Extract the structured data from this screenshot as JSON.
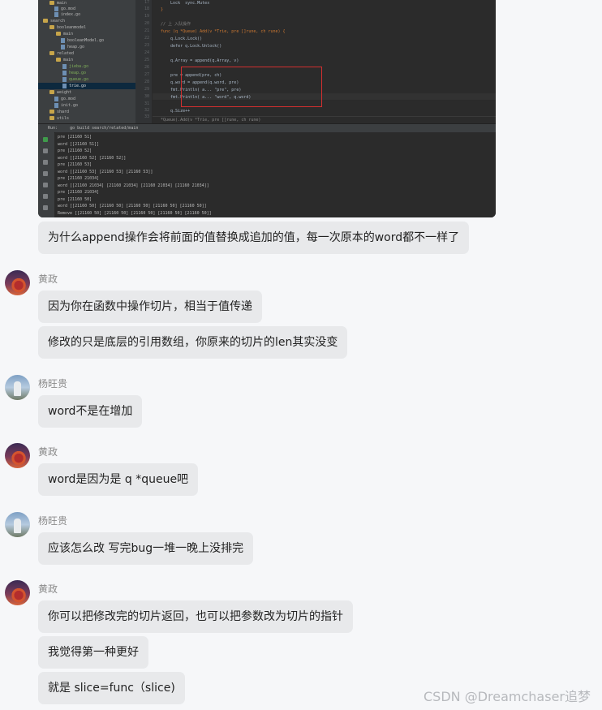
{
  "ide": {
    "tree": [
      "main",
      "go.mod",
      "index.go",
      "search",
      "booleanmodel",
      "main",
      "booleanModel.go",
      "heap.go",
      "related",
      "main",
      "jieba.go",
      "heap.go",
      "queue.go",
      "trie.go",
      "weight",
      "go.mod",
      "init.go",
      "shard",
      "utils"
    ],
    "code": [
      "    Lock  sync.Mutex",
      "}",
      "",
      "// 上 入队操作",
      "func (q *Queue) Add(v *Trie, pre []rune, ch rune) {",
      "    q.Lock.Lock()",
      "    defer q.Lock.Unlock()",
      "",
      "    q.Array = append(q.Array, v)",
      "",
      "    pre = append(pre, ch)",
      "    q.word = append(q.word, pre)",
      "    fmt.Println( a... \"pre\", pre)",
      "    fmt.Println( a... \"word\", q.word)",
      "",
      "    q.Size++",
      "}"
    ],
    "line_numbers": [
      "17",
      "18",
      "19",
      "20",
      "21",
      "22",
      "23",
      "24",
      "25",
      "26",
      "27",
      "28",
      "29",
      "30",
      "31",
      "32",
      "33"
    ],
    "breadcrumb": "*Queue).Add(v *Trie, pre []rune, ch rune)",
    "run_tab": "go build search/related/main",
    "run_label": "Run:",
    "console": [
      "pre [21160 51]",
      "word [[21160 51]]",
      "pre [21160 52]",
      "word [[21160 52] [21160 52]]",
      "pre [21160 53]",
      "word [[21160 53] [21160 53] [21160 53]]",
      "pre [21160 21034]",
      "word [[21160 21034] [21160 21034] [21160 21034] [21160 21034]]",
      "pre [21160 21034]",
      "pre [21160 50]",
      "word [[21160 50] [21160 50] [21160 50] [21160 50] [21160 50]]",
      "Remove [[21160 50] [21160 50] [21160 50] [21160 50] [21160 50]]"
    ]
  },
  "messages": [
    {
      "text": "为什么append操作会将前面的值替换成追加的值，每一次原本的word都不一样了"
    },
    {
      "sender": "黄政",
      "bubbles": [
        "因为你在函数中操作切片，相当于值传递",
        "修改的只是底层的引用数组，你原来的切片的len其实没变"
      ]
    },
    {
      "sender": "杨旺贵",
      "bubbles": [
        "word不是在增加"
      ]
    },
    {
      "sender": "黄政",
      "bubbles": [
        "word是因为是 q *queue吧"
      ]
    },
    {
      "sender": "杨旺贵",
      "bubbles": [
        "应该怎么改  写完bug一堆一晚上没排完"
      ]
    },
    {
      "sender": "黄政",
      "bubbles": [
        "你可以把修改完的切片返回，也可以把参数改为切片的指针",
        "我觉得第一种更好",
        "就是 slice=func（slice)"
      ]
    }
  ],
  "watermark": "CSDN @Dreamchaser追梦"
}
